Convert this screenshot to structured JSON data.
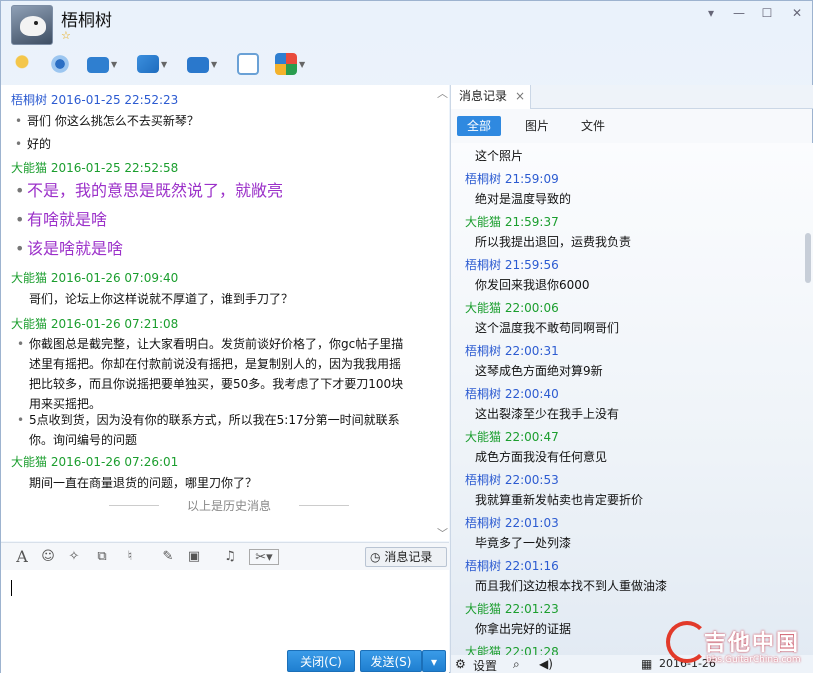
{
  "header": {
    "contact_name": "梧桐树",
    "star": "☆"
  },
  "window_controls": {
    "minimize": "▾",
    "restore": "—",
    "maximize": "☐",
    "close": "✕"
  },
  "toolbar_icons": [
    "microphone-icon",
    "video-camera-icon",
    "screen-share-icon",
    "file-transfer-icon",
    "remote-desktop-icon",
    "new-message-icon",
    "apps-icon"
  ],
  "chat": {
    "messages": [
      {
        "sender": "梧桐树",
        "time": "2016-01-25 22:52:23",
        "lines": [
          "哥们 你这么挑怎么不去买新琴？",
          "好的"
        ]
      },
      {
        "sender": "大能猫",
        "time": "2016-01-25 22:52:58",
        "lines": [
          "不是，我的意思是既然说了，就敞亮",
          "有啥就是啥",
          "该是啥就是啥"
        ]
      },
      {
        "sender": "大能猫",
        "time": "2016-01-26 07:09:40",
        "lines": [
          "哥们，论坛上你这样说就不厚道了，谁到手刀了？"
        ]
      },
      {
        "sender": "大能猫",
        "time": "2016-01-26 07:21:08",
        "lines": [
          "你截图总是截完整，让大家看明白。发货前谈好价格了，你gc帖子里描",
          "述里有摇把。你却在付款前说没有摇把，是复制别人的，因为我我用摇",
          "把比较多，而且你说摇把要单独买，要50多。我考虑了下才要刀100块",
          "用来买摇把。",
          "5点收到货，因为没有你的联系方式，所以我在5:17分第一时间就联系",
          "你。询问编号的问题"
        ]
      },
      {
        "sender": "大能猫",
        "time": "2016-01-26 07:26:01",
        "lines": [
          "期间一直在商量退货的问题，哪里刀你了？"
        ]
      }
    ],
    "history_divider": "以上是历史消息"
  },
  "editor": {
    "history_button": "消息记录",
    "close_button": "关闭(C)",
    "send_button": "发送(S)"
  },
  "right_panel": {
    "tab_label": "消息记录",
    "filters": [
      "全部",
      "图片",
      "文件"
    ],
    "records": [
      {
        "type": "text",
        "text": "这个照片"
      },
      {
        "type": "head",
        "sender": "梧桐树",
        "time": "21:59:09"
      },
      {
        "type": "text",
        "text": "绝对是温度导致的"
      },
      {
        "type": "head",
        "sender": "大能猫",
        "time": "21:59:37"
      },
      {
        "type": "text",
        "text": "所以我提出退回，运费我负责"
      },
      {
        "type": "head",
        "sender": "梧桐树",
        "time": "21:59:56"
      },
      {
        "type": "text",
        "text": "你发回来我退你6000"
      },
      {
        "type": "head",
        "sender": "大能猫",
        "time": "22:00:06"
      },
      {
        "type": "text",
        "text": "这个温度我不敢苟同啊哥们"
      },
      {
        "type": "head",
        "sender": "梧桐树",
        "time": "22:00:31"
      },
      {
        "type": "text",
        "text": "这琴成色方面绝对算9新"
      },
      {
        "type": "head",
        "sender": "梧桐树",
        "time": "22:00:40"
      },
      {
        "type": "text",
        "text": "这出裂漆至少在我手上没有"
      },
      {
        "type": "head",
        "sender": "大能猫",
        "time": "22:00:47"
      },
      {
        "type": "text",
        "text": "成色方面我没有任何意见"
      },
      {
        "type": "head",
        "sender": "梧桐树",
        "time": "22:00:53"
      },
      {
        "type": "text",
        "text": "我就算重新发帖卖也肯定要折价"
      },
      {
        "type": "head",
        "sender": "梧桐树",
        "time": "22:01:03"
      },
      {
        "type": "text",
        "text": "毕竟多了一处列漆"
      },
      {
        "type": "head",
        "sender": "梧桐树",
        "time": "22:01:16"
      },
      {
        "type": "text",
        "text": "而且我们这边根本找不到人重做油漆"
      },
      {
        "type": "head",
        "sender": "大能猫",
        "time": "22:01:23"
      },
      {
        "type": "text",
        "text": "你拿出完好的证据"
      },
      {
        "type": "head",
        "sender": "大能猫",
        "time": "22:01:28"
      }
    ],
    "settings_label": "设置",
    "date": "2016-1-26"
  },
  "watermark": {
    "name": "吉他中国",
    "url": "bbs.GuitarChina.com"
  },
  "colors": {
    "sender_self": "#2c5bd1",
    "sender_other": "#1b9e2e",
    "highlight_text": "#9b30c9",
    "accent": "#2f89e0"
  }
}
